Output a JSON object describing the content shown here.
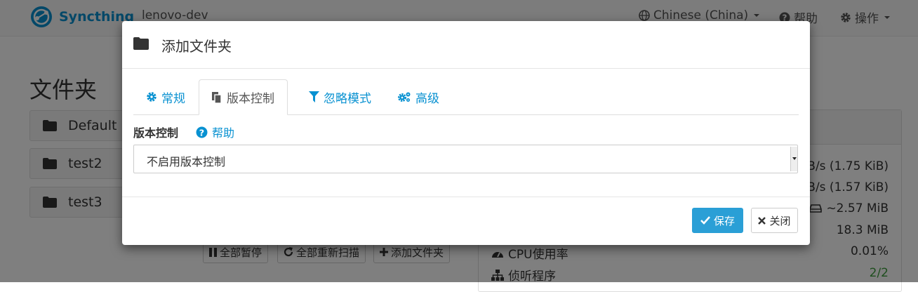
{
  "colors": {
    "accent": "#0891d1",
    "primary_button": "#2a9fd6",
    "success": "#3c9d3c"
  },
  "navbar": {
    "brand": "Syncthing",
    "device": "lenovo-dev",
    "language": "Chinese (China)",
    "help": "帮助",
    "actions": "操作"
  },
  "folders": {
    "title": "文件夹",
    "items": [
      {
        "label": "Default"
      },
      {
        "label": "test2"
      },
      {
        "label": "test3"
      }
    ],
    "buttons": {
      "pause_all": "全部暂停",
      "rescan_all": "全部重新扫描",
      "add_folder": "添加文件夹"
    }
  },
  "this_device": {
    "rows": [
      {
        "value": "B/s (1.75 KiB)"
      },
      {
        "value": "B/s (1.57 KiB)"
      },
      {
        "value": "~2.57 MiB",
        "icon": "hdd-icon"
      },
      {
        "value": "18.3 MiB"
      },
      {
        "label": "CPU使用率",
        "value": "0.01%",
        "icon": "dashboard-icon"
      },
      {
        "label": "侦听程序",
        "value": "2/2",
        "icon": "sitemap-icon"
      }
    ]
  },
  "modal": {
    "title": "添加文件夹",
    "tabs": [
      {
        "label": "常规",
        "icon": "cog-icon"
      },
      {
        "label": "版本控制",
        "icon": "copy-icon",
        "active": true
      },
      {
        "label": "忽略模式",
        "icon": "filter-icon"
      },
      {
        "label": "高级",
        "icon": "cogs-icon"
      }
    ],
    "versioning": {
      "label": "版本控制",
      "help": "帮助",
      "selected": "不启用版本控制"
    },
    "save": "保存",
    "close": "关闭"
  }
}
